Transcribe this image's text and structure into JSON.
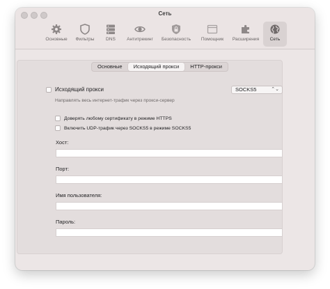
{
  "window": {
    "title": "Сеть"
  },
  "toolbar": {
    "items": [
      {
        "label": "Основные",
        "icon": "gear-icon"
      },
      {
        "label": "Фильтры",
        "icon": "shield-icon"
      },
      {
        "label": "DNS",
        "icon": "server-icon"
      },
      {
        "label": "Антитрекинг",
        "icon": "eye-icon"
      },
      {
        "label": "Безопасность",
        "icon": "lock-shield-icon"
      },
      {
        "label": "Помощник",
        "icon": "browser-window-icon"
      },
      {
        "label": "Расширения",
        "icon": "puzzle-icon"
      },
      {
        "label": "Сеть",
        "icon": "globe-icon",
        "active": true
      }
    ]
  },
  "tabs": [
    {
      "label": "Основные"
    },
    {
      "label": "Исходящий прокси",
      "active": true
    },
    {
      "label": "HTTP-прокси"
    }
  ],
  "proxy": {
    "enable_label": "Исходящий прокси",
    "type_value": "SOCKS5",
    "hint": "Направлять весь интернет-трафик через прокси-сервер",
    "trust_label": "Доверять любому сертификату в режиме HTTPS",
    "udp_label": "Включить UDP-трафик через SOCKS5 в режиме SOCKS5",
    "host_label": "Хост:",
    "host_value": "",
    "port_label": "Порт:",
    "port_value": "",
    "user_label": "Имя пользователя:",
    "user_value": "",
    "pass_label": "Пароль:",
    "pass_value": ""
  }
}
